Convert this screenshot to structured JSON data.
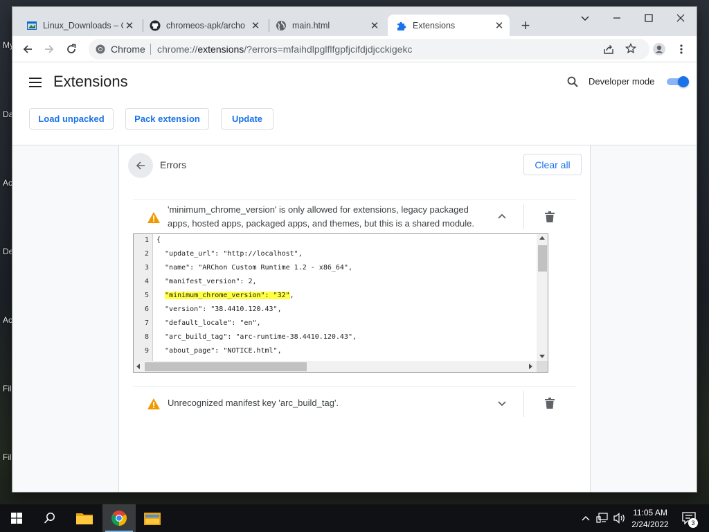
{
  "desktop": {
    "labels": [
      "My",
      "Da",
      "Ac",
      "De",
      "Ac",
      "Fil",
      "Fil"
    ]
  },
  "browser": {
    "tabs": [
      {
        "title": "Linux_Downloads – O",
        "favicon": "window-icon"
      },
      {
        "title": "chromeos-apk/archo",
        "favicon": "github-icon"
      },
      {
        "title": "main.html",
        "favicon": "globe-icon"
      },
      {
        "title": "Extensions",
        "favicon": "puzzle-icon",
        "active": true
      }
    ],
    "omnibox": {
      "site_label": "Chrome",
      "url_prefix": "chrome://",
      "url_host": "extensions",
      "url_rest": "/?errors=mfaihdlpglflfgpfjcifdjdjcckigekc"
    }
  },
  "extensions_page": {
    "title": "Extensions",
    "developer_mode_label": "Developer mode",
    "developer_mode_on": true,
    "buttons": {
      "load_unpacked": "Load unpacked",
      "pack_extension": "Pack extension",
      "update": "Update"
    },
    "errors_panel": {
      "title": "Errors",
      "clear_all": "Clear all",
      "errors": [
        {
          "message": "'minimum_chrome_version' is only allowed for extensions, legacy packaged apps, hosted apps, packaged apps, and themes, but this is a shared module.",
          "expanded": true
        },
        {
          "message": "Unrecognized manifest key 'arc_build_tag'.",
          "expanded": false
        }
      ],
      "code_lines": [
        {
          "n": "1",
          "text": "{"
        },
        {
          "n": "2",
          "text": "  \"update_url\": \"http://localhost\","
        },
        {
          "n": "3",
          "text": "  \"name\": \"ARChon Custom Runtime 1.2 - x86_64\","
        },
        {
          "n": "4",
          "text": "  \"manifest_version\": 2,"
        },
        {
          "n": "5",
          "text": "  \"minimum_chrome_version\": \"32\"",
          "highlight": true,
          "trail": ","
        },
        {
          "n": "6",
          "text": "  \"version\": \"38.4410.120.43\","
        },
        {
          "n": "7",
          "text": "  \"default_locale\": \"en\","
        },
        {
          "n": "8",
          "text": "  \"arc_build_tag\": \"arc-runtime-38.4410.120.43\","
        },
        {
          "n": "9",
          "text": "  \"about_page\": \"NOTICE.html\","
        }
      ]
    }
  },
  "taskbar": {
    "time": "11:05 AM",
    "date": "2/24/2022",
    "notification_count": "3"
  },
  "colors": {
    "accent": "#1a73e8",
    "warning": "#f29900",
    "highlight": "#ffff40"
  }
}
